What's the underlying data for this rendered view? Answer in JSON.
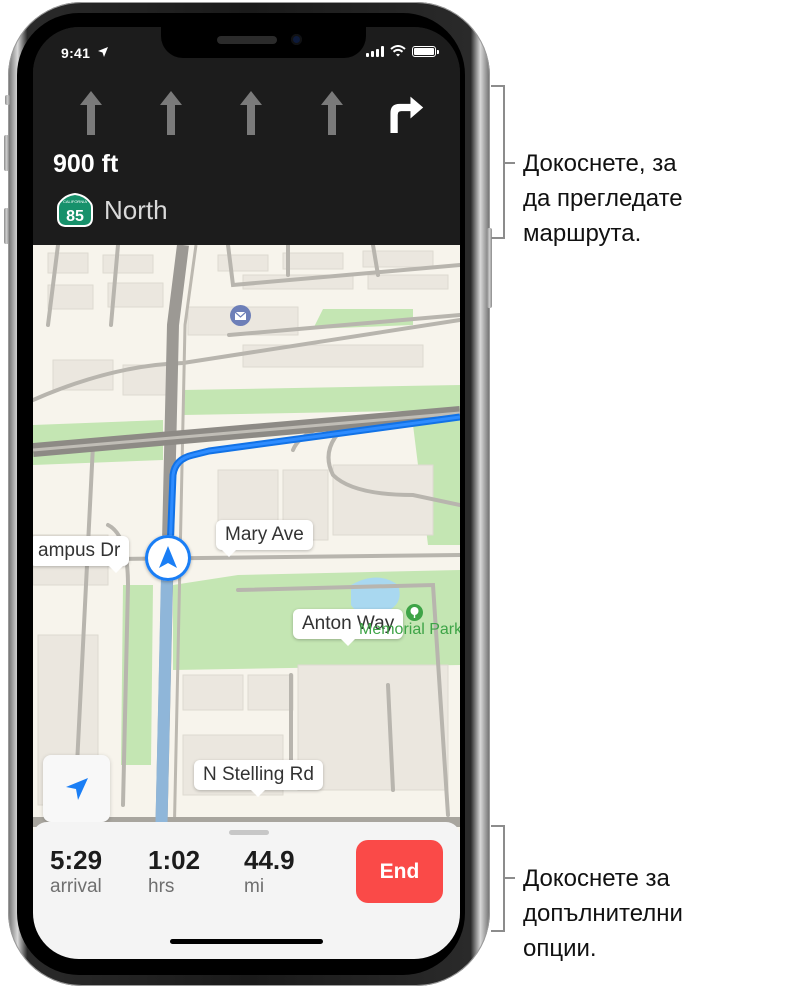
{
  "status_bar": {
    "time": "9:41",
    "location_icon": "location-arrow-icon",
    "signal_icon": "cellular-signal-icon",
    "wifi_icon": "wifi-icon",
    "battery_icon": "battery-icon"
  },
  "nav_banner": {
    "lanes": [
      {
        "icon": "lane-straight-arrow-icon",
        "active": false
      },
      {
        "icon": "lane-straight-arrow-icon",
        "active": false
      },
      {
        "icon": "lane-straight-arrow-icon",
        "active": false
      },
      {
        "icon": "lane-straight-arrow-icon",
        "active": false
      },
      {
        "icon": "turn-right-arrow-icon",
        "active": true
      }
    ],
    "distance": "900 ft",
    "shield": {
      "state": "CALIFORNIA",
      "number": "85",
      "color": "#17916b"
    },
    "road_name": "North"
  },
  "map": {
    "labels": {
      "campus": "ampus Dr",
      "mary": "Mary Ave",
      "anton": "Anton Way",
      "stelling": "N Stelling Rd",
      "park": "Memorial Park"
    },
    "poi_icons": [
      "mail-icon",
      "park-tree-icon"
    ],
    "route_color": "#1a7ef5",
    "user_marker_icon": "navigation-arrow-icon",
    "locate_button_icon": "location-arrow-icon"
  },
  "trip_card": {
    "stats": [
      {
        "value": "5:29",
        "unit": "arrival"
      },
      {
        "value": "1:02",
        "unit": "hrs"
      },
      {
        "value": "44.9",
        "unit": "mi"
      }
    ],
    "end_label": "End",
    "end_color": "#fa4a48"
  },
  "annotations": {
    "top": [
      "Докоснете, за",
      "да прегледате",
      "маршрута."
    ],
    "bottom": [
      "Докоснете за",
      "допълнителни",
      "опции."
    ]
  }
}
